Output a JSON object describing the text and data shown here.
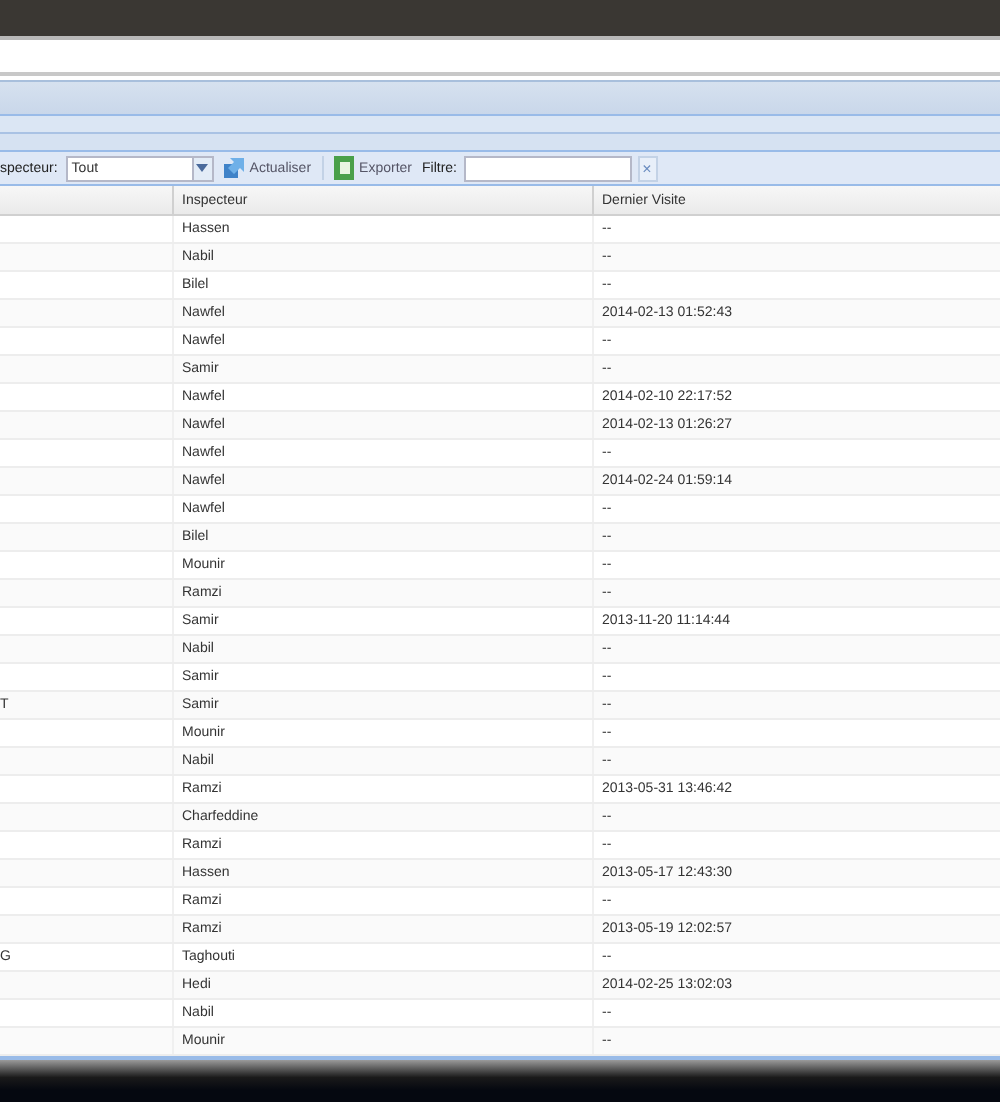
{
  "toolbar": {
    "inspector_label": "specteur:",
    "inspector_value": "Tout",
    "refresh_label": "Actualiser",
    "export_label": "Exporter",
    "filter_label": "Filtre:",
    "clear": "×"
  },
  "table": {
    "columns": [
      "Inspecteur",
      "Dernier Visite"
    ],
    "rows": [
      {
        "column_1": "",
        "inspecteur": "Hassen",
        "visite": "--"
      },
      {
        "column_1": "",
        "inspecteur": "Nabil",
        "visite": "--"
      },
      {
        "column_1": "",
        "inspecteur": "Bilel",
        "visite": "--"
      },
      {
        "column_1": "",
        "inspecteur": "Nawfel",
        "visite": "2014-02-13 01:52:43"
      },
      {
        "column_1": "",
        "inspecteur": "Nawfel",
        "visite": "--"
      },
      {
        "column_1": "",
        "inspecteur": "Samir",
        "visite": "--"
      },
      {
        "column_1": "",
        "inspecteur": "Nawfel",
        "visite": "2014-02-10 22:17:52"
      },
      {
        "column_1": "",
        "inspecteur": "Nawfel",
        "visite": "2014-02-13 01:26:27"
      },
      {
        "column_1": "",
        "inspecteur": "Nawfel",
        "visite": "--"
      },
      {
        "column_1": "",
        "inspecteur": "Nawfel",
        "visite": "2014-02-24 01:59:14"
      },
      {
        "column_1": "",
        "inspecteur": "Nawfel",
        "visite": "--"
      },
      {
        "column_1": "",
        "inspecteur": "Bilel",
        "visite": "--"
      },
      {
        "column_1": "",
        "inspecteur": "Mounir",
        "visite": "--"
      },
      {
        "column_1": "",
        "inspecteur": "Ramzi",
        "visite": "--"
      },
      {
        "column_1": "",
        "inspecteur": "Samir",
        "visite": "2013-11-20 11:14:44"
      },
      {
        "column_1": "",
        "inspecteur": "Nabil",
        "visite": "--"
      },
      {
        "column_1": "",
        "inspecteur": "Samir",
        "visite": "--"
      },
      {
        "column_1": "T",
        "inspecteur": "Samir",
        "visite": "--"
      },
      {
        "column_1": "",
        "inspecteur": "Mounir",
        "visite": "--"
      },
      {
        "column_1": "",
        "inspecteur": "Nabil",
        "visite": "--"
      },
      {
        "column_1": "",
        "inspecteur": "Ramzi",
        "visite": "2013-05-31 13:46:42"
      },
      {
        "column_1": "",
        "inspecteur": "Charfeddine",
        "visite": "--"
      },
      {
        "column_1": "",
        "inspecteur": "Ramzi",
        "visite": "--"
      },
      {
        "column_1": "",
        "inspecteur": "Hassen",
        "visite": "2013-05-17 12:43:30"
      },
      {
        "column_1": "",
        "inspecteur": "Ramzi",
        "visite": "--"
      },
      {
        "column_1": "",
        "inspecteur": "Ramzi",
        "visite": "2013-05-19 12:02:57"
      },
      {
        "column_1": "G",
        "inspecteur": "Taghouti",
        "visite": "--"
      },
      {
        "column_1": "",
        "inspecteur": "Hedi",
        "visite": "2014-02-25 13:02:03"
      },
      {
        "column_1": "",
        "inspecteur": "Nabil",
        "visite": "--"
      },
      {
        "column_1": "",
        "inspecteur": "Mounir",
        "visite": "--"
      }
    ]
  }
}
